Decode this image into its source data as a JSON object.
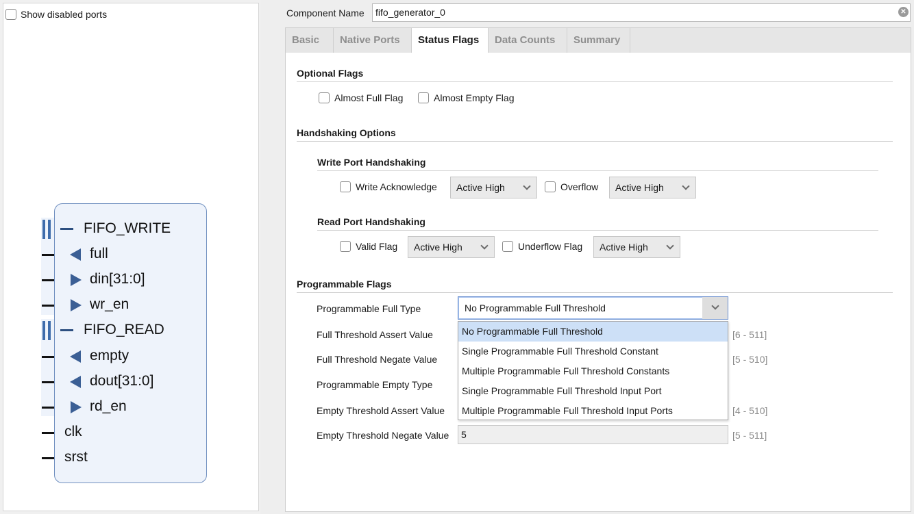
{
  "left_panel": {
    "show_disabled_label": "Show disabled ports",
    "ports": [
      {
        "label": "FIFO_WRITE",
        "kind": "bus"
      },
      {
        "label": "full",
        "kind": "out"
      },
      {
        "label": "din[31:0]",
        "kind": "in"
      },
      {
        "label": "wr_en",
        "kind": "in"
      },
      {
        "label": "FIFO_READ",
        "kind": "bus"
      },
      {
        "label": "empty",
        "kind": "out"
      },
      {
        "label": "dout[31:0]",
        "kind": "out"
      },
      {
        "label": "rd_en",
        "kind": "in"
      },
      {
        "label": "clk",
        "kind": "plain"
      },
      {
        "label": "srst",
        "kind": "plain"
      }
    ]
  },
  "component": {
    "label": "Component Name",
    "value": "fifo_generator_0"
  },
  "tabs": [
    {
      "label": "Basic",
      "active": false
    },
    {
      "label": "Native Ports",
      "active": false
    },
    {
      "label": "Status Flags",
      "active": true
    },
    {
      "label": "Data Counts",
      "active": false
    },
    {
      "label": "Summary",
      "active": false
    }
  ],
  "optional_flags": {
    "title": "Optional Flags",
    "almost_full": "Almost Full Flag",
    "almost_empty": "Almost Empty Flag"
  },
  "handshaking": {
    "title": "Handshaking Options",
    "write": {
      "title": "Write Port Handshaking",
      "write_ack": "Write Acknowledge",
      "write_ack_value": "Active High",
      "overflow": "Overflow",
      "overflow_value": "Active High"
    },
    "read": {
      "title": "Read Port Handshaking",
      "valid": "Valid Flag",
      "valid_value": "Active High",
      "underflow": "Underflow Flag",
      "underflow_value": "Active High"
    }
  },
  "programmable": {
    "title": "Programmable Flags",
    "full_type_label": "Programmable Full Type",
    "full_type_value": "No Programmable Full Threshold",
    "options": [
      "No Programmable Full Threshold",
      "Single Programmable Full Threshold Constant",
      "Multiple Programmable Full Threshold Constants",
      "Single Programmable Full Threshold Input Port",
      "Multiple Programmable Full Threshold Input Ports"
    ],
    "full_assert_label": "Full Threshold Assert Value",
    "full_assert_range": "[6 - 511]",
    "full_negate_label": "Full Threshold Negate Value",
    "full_negate_range": "[5 - 510]",
    "empty_type_label": "Programmable Empty Type",
    "empty_assert_label": "Empty Threshold Assert Value",
    "empty_assert_range": "[4 - 510]",
    "empty_negate_label": "Empty Threshold Negate Value",
    "empty_negate_value": "5",
    "empty_negate_range": "[5 - 511]"
  }
}
